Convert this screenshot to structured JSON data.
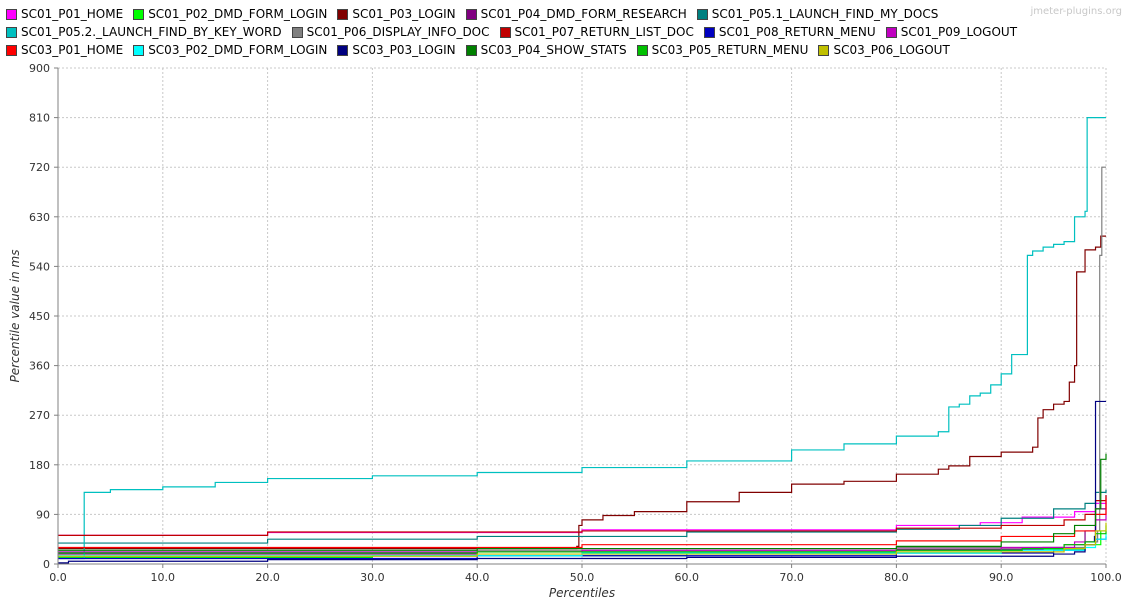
{
  "watermark": "jmeter-plugins.org",
  "chart_data": {
    "type": "line",
    "xlabel": "Percentiles",
    "ylabel": "Percentile value in ms",
    "xlim": [
      0,
      100
    ],
    "ylim": [
      0,
      900
    ],
    "xticks": [
      "0.0",
      "10.0",
      "20.0",
      "30.0",
      "40.0",
      "50.0",
      "60.0",
      "70.0",
      "80.0",
      "90.0",
      "100.0"
    ],
    "yticks": [
      "0",
      "90",
      "180",
      "270",
      "360",
      "450",
      "540",
      "630",
      "720",
      "810",
      "900"
    ],
    "grid": true,
    "legend_placement": "top",
    "legend_rows": [
      [
        "SC01_P01_HOME",
        "SC01_P02_DMD_FORM_LOGIN",
        "SC01_P03_LOGIN",
        "SC01_P04_DMD_FORM_RESEARCH",
        "SC01_P05.1_LAUNCH_FIND_MY_DOCS"
      ],
      [
        "SC01_P05.2._LAUNCH_FIND_BY_KEY_WORD",
        "SC01_P06_DISPLAY_INFO_DOC",
        "SC01_P07_RETURN_LIST_DOC",
        "SC01_P08_RETURN_MENU",
        "SC01_P09_LOGOUT"
      ],
      [
        "SC03_P01_HOME",
        "SC03_P02_DMD_FORM_LOGIN",
        "SC03_P03_LOGIN",
        "SC03_P04_SHOW_STATS",
        "SC03_P05_RETURN_MENU",
        "SC03_P06_LOGOUT"
      ]
    ],
    "series": [
      {
        "name": "SC01_P01_HOME",
        "color": "#ff00ff",
        "points": [
          [
            0,
            52
          ],
          [
            20,
            57
          ],
          [
            50,
            62
          ],
          [
            80,
            70
          ],
          [
            88,
            75
          ],
          [
            92,
            85
          ],
          [
            97,
            95
          ],
          [
            99,
            110
          ],
          [
            100,
            115
          ]
        ]
      },
      {
        "name": "SC01_P02_DMD_FORM_LOGIN",
        "color": "#00ff00",
        "points": [
          [
            0,
            12
          ],
          [
            30,
            15
          ],
          [
            60,
            20
          ],
          [
            90,
            26
          ],
          [
            98,
            35
          ],
          [
            99.5,
            60
          ],
          [
            100,
            70
          ]
        ]
      },
      {
        "name": "SC01_P03_LOGIN",
        "color": "#800000",
        "points": [
          [
            0,
            28
          ],
          [
            49.5,
            32
          ],
          [
            49.7,
            70
          ],
          [
            50,
            80
          ],
          [
            52,
            88
          ],
          [
            55,
            95
          ],
          [
            60,
            113
          ],
          [
            65,
            130
          ],
          [
            70,
            145
          ],
          [
            75,
            150
          ],
          [
            80,
            163
          ],
          [
            84,
            172
          ],
          [
            85,
            178
          ],
          [
            87,
            195
          ],
          [
            90,
            203
          ],
          [
            93,
            212
          ],
          [
            93.5,
            265
          ],
          [
            94,
            280
          ],
          [
            95,
            290
          ],
          [
            96,
            295
          ],
          [
            96.5,
            330
          ],
          [
            97,
            360
          ],
          [
            97.2,
            530
          ],
          [
            98,
            570
          ],
          [
            99,
            575
          ],
          [
            99.5,
            595
          ],
          [
            100,
            595
          ]
        ]
      },
      {
        "name": "SC01_P04_DMD_FORM_RESEARCH",
        "color": "#800080",
        "points": [
          [
            0,
            18
          ],
          [
            40,
            22
          ],
          [
            80,
            27
          ],
          [
            94,
            30
          ],
          [
            96,
            35
          ],
          [
            98,
            60
          ],
          [
            99,
            100
          ],
          [
            100,
            125
          ]
        ]
      },
      {
        "name": "SC01_P05.1_LAUNCH_FIND_MY_DOCS",
        "color": "#008080",
        "points": [
          [
            0,
            38
          ],
          [
            20,
            45
          ],
          [
            40,
            50
          ],
          [
            60,
            58
          ],
          [
            80,
            63
          ],
          [
            86,
            70
          ],
          [
            90,
            83
          ],
          [
            95,
            100
          ],
          [
            98,
            110
          ],
          [
            99,
            130
          ],
          [
            100,
            135
          ]
        ]
      },
      {
        "name": "SC01_P05.2._LAUNCH_FIND_BY_KEY_WORD",
        "color": "#00c0c0",
        "points": [
          [
            0,
            10
          ],
          [
            2.3,
            10
          ],
          [
            2.5,
            130
          ],
          [
            5,
            135
          ],
          [
            10,
            140
          ],
          [
            15,
            148
          ],
          [
            20,
            155
          ],
          [
            30,
            160
          ],
          [
            40,
            166
          ],
          [
            50,
            175
          ],
          [
            60,
            187
          ],
          [
            70,
            207
          ],
          [
            75,
            218
          ],
          [
            80,
            232
          ],
          [
            84,
            240
          ],
          [
            85,
            285
          ],
          [
            86,
            290
          ],
          [
            87,
            305
          ],
          [
            88,
            310
          ],
          [
            89,
            325
          ],
          [
            90,
            345
          ],
          [
            91,
            380
          ],
          [
            92,
            380
          ],
          [
            92.5,
            560
          ],
          [
            93,
            568
          ],
          [
            94,
            575
          ],
          [
            95,
            580
          ],
          [
            96,
            585
          ],
          [
            97,
            630
          ],
          [
            98,
            640
          ],
          [
            98.2,
            810
          ],
          [
            99,
            810
          ],
          [
            100,
            810
          ]
        ]
      },
      {
        "name": "SC01_P06_DISPLAY_INFO_DOC",
        "color": "#808080",
        "points": [
          [
            0,
            20
          ],
          [
            40,
            25
          ],
          [
            80,
            30
          ],
          [
            98,
            40
          ],
          [
            99.2,
            60
          ],
          [
            99.4,
            560
          ],
          [
            99.6,
            720
          ],
          [
            100,
            720
          ]
        ]
      },
      {
        "name": "SC01_P07_RETURN_LIST_DOC",
        "color": "#c00000",
        "points": [
          [
            0,
            52
          ],
          [
            20,
            58
          ],
          [
            50,
            60
          ],
          [
            80,
            65
          ],
          [
            90,
            70
          ],
          [
            96,
            80
          ],
          [
            98,
            90
          ],
          [
            99,
            115
          ],
          [
            100,
            125
          ]
        ]
      },
      {
        "name": "SC01_P08_RETURN_MENU",
        "color": "#0000c0",
        "points": [
          [
            0,
            10
          ],
          [
            40,
            15
          ],
          [
            80,
            20
          ],
          [
            95,
            25
          ],
          [
            98,
            35
          ],
          [
            99,
            45
          ],
          [
            100,
            50
          ]
        ]
      },
      {
        "name": "SC01_P09_LOGOUT",
        "color": "#c000c0",
        "points": [
          [
            0,
            22
          ],
          [
            50,
            25
          ],
          [
            90,
            30
          ],
          [
            97,
            40
          ],
          [
            99,
            80
          ],
          [
            100,
            110
          ]
        ]
      },
      {
        "name": "SC03_P01_HOME",
        "color": "#ff0000",
        "points": [
          [
            0,
            30
          ],
          [
            50,
            35
          ],
          [
            80,
            42
          ],
          [
            90,
            50
          ],
          [
            97,
            60
          ],
          [
            99,
            90
          ],
          [
            100,
            120
          ]
        ]
      },
      {
        "name": "SC03_P02_DMD_FORM_LOGIN",
        "color": "#00ffff",
        "points": [
          [
            0,
            15
          ],
          [
            50,
            20
          ],
          [
            90,
            25
          ],
          [
            98,
            30
          ],
          [
            99,
            45
          ],
          [
            100,
            55
          ]
        ]
      },
      {
        "name": "SC03_P03_LOGIN",
        "color": "#000080",
        "points": [
          [
            0,
            2
          ],
          [
            1,
            5
          ],
          [
            20,
            8
          ],
          [
            40,
            10
          ],
          [
            60,
            12
          ],
          [
            80,
            14
          ],
          [
            95,
            18
          ],
          [
            97,
            22
          ],
          [
            98,
            40
          ],
          [
            98.9,
            50
          ],
          [
            99,
            295
          ],
          [
            100,
            295
          ]
        ]
      },
      {
        "name": "SC03_P04_SHOW_STATS",
        "color": "#008000",
        "points": [
          [
            0,
            25
          ],
          [
            40,
            28
          ],
          [
            80,
            32
          ],
          [
            90,
            40
          ],
          [
            95,
            55
          ],
          [
            97,
            70
          ],
          [
            99,
            100
          ],
          [
            99.5,
            190
          ],
          [
            100,
            200
          ]
        ]
      },
      {
        "name": "SC03_P05_RETURN_MENU",
        "color": "#00c000",
        "points": [
          [
            0,
            20
          ],
          [
            40,
            22
          ],
          [
            80,
            25
          ],
          [
            92,
            28
          ],
          [
            96,
            35
          ],
          [
            98,
            40
          ],
          [
            99,
            55
          ],
          [
            100,
            60
          ]
        ]
      },
      {
        "name": "SC03_P06_LOGOUT",
        "color": "#c0c000",
        "points": [
          [
            0,
            14
          ],
          [
            40,
            18
          ],
          [
            80,
            22
          ],
          [
            96,
            28
          ],
          [
            98,
            35
          ],
          [
            99,
            60
          ],
          [
            100,
            75
          ]
        ]
      }
    ]
  }
}
